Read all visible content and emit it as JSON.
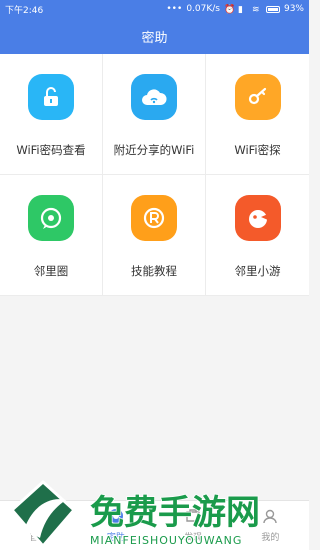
{
  "statusbar": {
    "time": "下午2:46",
    "speed": "0.07K/s",
    "battery": "93%"
  },
  "header": {
    "title": "密助"
  },
  "grid": {
    "items": [
      {
        "label": "WiFi密码查看",
        "icon": "unlock-icon",
        "color": "#29b6f6"
      },
      {
        "label": "附近分享的WiFi",
        "icon": "cloud-wifi-icon",
        "color": "#2aa9f0"
      },
      {
        "label": "WiFi密探",
        "icon": "key-icon",
        "color": "#ffa726"
      },
      {
        "label": "邻里圈",
        "icon": "chat-bubble-icon",
        "color": "#2ec866"
      },
      {
        "label": "技能教程",
        "icon": "r-badge-icon",
        "color": "#ff9f1a"
      },
      {
        "label": "邻里小游",
        "icon": "game-face-icon",
        "color": "#f45a2a"
      }
    ]
  },
  "tabbar": {
    "tabs": [
      {
        "label": "首页",
        "icon": "home-icon"
      },
      {
        "label": "密助",
        "icon": "assistant-icon",
        "active": true
      },
      {
        "label": "发现",
        "icon": "discover-icon"
      },
      {
        "label": "我的",
        "icon": "profile-icon"
      }
    ]
  },
  "watermark": {
    "title": "免费手游网",
    "subtitle": "MIANFEISHOUYOUWANG"
  },
  "colors": {
    "primary": "#4a7ee6"
  }
}
